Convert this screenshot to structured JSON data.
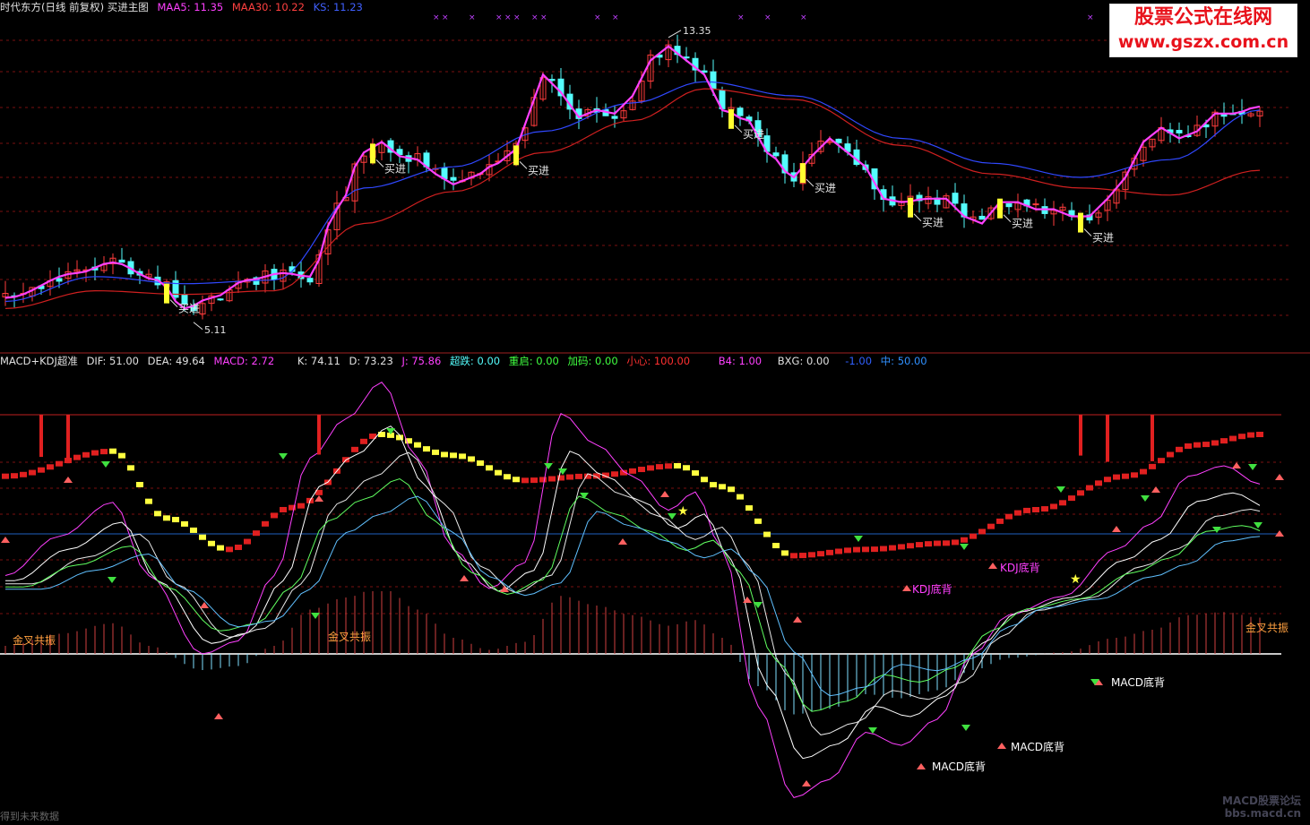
{
  "header_main": {
    "title": "时代东方(日线 前复权) 买进主图",
    "maa5_label": "MAA5: 11.35",
    "maa30_label": "MAA30: 10.22",
    "ks_label": "KS: 11.23"
  },
  "header_indicator": {
    "name": "MACD+KDJ超准",
    "dif": "DIF: 51.00",
    "dea": "DEA: 49.64",
    "macd": "MACD: 2.72",
    "k": "K: 74.11",
    "d": "D: 73.23",
    "j": "J: 75.86",
    "chaodie": "超跌: 0.00",
    "zhongqi": "重启: 0.00",
    "jiama": "加码: 0.00",
    "xiaoxin": "小心: 100.00",
    "b4": "B4: 1.00",
    "bxg": "BXG: 0.00",
    "neg": "-1.00",
    "zhong": "中: 50.00"
  },
  "watermark": {
    "line1": "股票公式在线网",
    "line2": "www.gszx.com.cn",
    "corner1": "MACD股票论坛",
    "corner2": "bbs.macd.cn"
  },
  "footer": "得到未来数据",
  "colors": {
    "up": "#ff3c3c",
    "down": "#54fcfc",
    "maa5": "#ff40ff",
    "maa30": "#d02020",
    "ks": "#3048ff",
    "signal": "#ffff30",
    "grid": "#7a1010"
  },
  "chart_data": [
    {
      "type": "candlestick",
      "title": "时代东方(日线 前复权) 买进主图",
      "series": [
        {
          "name": "MAA5",
          "last": 11.35
        },
        {
          "name": "MAA30",
          "last": 10.22
        },
        {
          "name": "KS",
          "last": 11.23
        }
      ],
      "ylim": [
        4.7,
        13.8
      ],
      "annotations": {
        "high": "13.35",
        "low": "5.11",
        "buy_label": "买进",
        "buy_signals_x": [
          18,
          41,
          57,
          81,
          89,
          101,
          111,
          120
        ]
      },
      "close_path": [
        [
          0,
          5.9
        ],
        [
          8,
          6.6
        ],
        [
          12,
          6.9
        ],
        [
          17,
          6.4
        ],
        [
          20,
          5.6
        ],
        [
          23,
          5.9
        ],
        [
          27,
          6.4
        ],
        [
          31,
          6.6
        ],
        [
          34,
          6.5
        ],
        [
          37,
          8.4
        ],
        [
          40,
          10.0
        ],
        [
          42,
          10.3
        ],
        [
          44,
          9.9
        ],
        [
          46,
          9.8
        ],
        [
          48,
          9.4
        ],
        [
          50,
          9.1
        ],
        [
          52,
          9.3
        ],
        [
          55,
          9.7
        ],
        [
          57,
          10.1
        ],
        [
          59,
          11.5
        ],
        [
          60,
          12.2
        ],
        [
          62,
          11.7
        ],
        [
          64,
          11.0
        ],
        [
          66,
          11.2
        ],
        [
          68,
          11.1
        ],
        [
          70,
          11.6
        ],
        [
          72,
          12.6
        ],
        [
          74,
          13.0
        ],
        [
          76,
          12.6
        ],
        [
          78,
          12.2
        ],
        [
          80,
          11.2
        ],
        [
          83,
          10.9
        ],
        [
          85,
          10.0
        ],
        [
          88,
          9.3
        ],
        [
          90,
          9.9
        ],
        [
          92,
          10.4
        ],
        [
          94,
          10.0
        ],
        [
          96,
          9.6
        ],
        [
          98,
          8.7
        ],
        [
          100,
          8.6
        ],
        [
          103,
          8.7
        ],
        [
          105,
          8.7
        ],
        [
          107,
          8.2
        ],
        [
          109,
          8.0
        ],
        [
          111,
          8.6
        ],
        [
          113,
          8.6
        ],
        [
          115,
          8.4
        ],
        [
          117,
          8.4
        ],
        [
          119,
          8.2
        ],
        [
          121,
          8.2
        ],
        [
          123,
          8.7
        ],
        [
          125,
          9.3
        ],
        [
          127,
          10.3
        ],
        [
          129,
          10.7
        ],
        [
          131,
          10.4
        ],
        [
          133,
          10.6
        ],
        [
          135,
          11.1
        ],
        [
          137,
          11.1
        ],
        [
          140,
          11.3
        ]
      ],
      "maa30_path": [
        [
          0,
          5.6
        ],
        [
          10,
          6.1
        ],
        [
          20,
          6.0
        ],
        [
          30,
          6.1
        ],
        [
          40,
          8.0
        ],
        [
          50,
          8.9
        ],
        [
          60,
          10.0
        ],
        [
          70,
          10.9
        ],
        [
          78,
          11.8
        ],
        [
          88,
          11.5
        ],
        [
          100,
          10.2
        ],
        [
          110,
          9.4
        ],
        [
          120,
          9.0
        ],
        [
          130,
          8.8
        ],
        [
          140,
          9.5
        ]
      ],
      "ks_path": [
        [
          0,
          5.8
        ],
        [
          10,
          6.5
        ],
        [
          20,
          6.3
        ],
        [
          30,
          6.4
        ],
        [
          40,
          9.0
        ],
        [
          50,
          9.6
        ],
        [
          60,
          10.6
        ],
        [
          70,
          11.4
        ],
        [
          78,
          12.0
        ],
        [
          88,
          11.6
        ],
        [
          100,
          10.4
        ],
        [
          110,
          9.7
        ],
        [
          120,
          9.3
        ],
        [
          130,
          9.8
        ],
        [
          140,
          11.2
        ]
      ]
    },
    {
      "type": "line",
      "title": "MACD+KDJ超准",
      "ylim": [
        -100,
        110
      ],
      "series": [
        {
          "name": "DIF",
          "last": 51.0
        },
        {
          "name": "DEA",
          "last": 49.64
        },
        {
          "name": "MACD",
          "last": 2.72
        },
        {
          "name": "K",
          "last": 74.11
        },
        {
          "name": "D",
          "last": 73.23
        },
        {
          "name": "J",
          "last": 75.86
        }
      ],
      "labels": {
        "kdj_bottom": "KDJ底背",
        "macd_bottom": "MACD底背",
        "gold_resonance": "金叉共振"
      },
      "wave_path": [
        [
          0,
          60
        ],
        [
          12,
          72
        ],
        [
          18,
          40
        ],
        [
          25,
          25
        ],
        [
          32,
          45
        ],
        [
          42,
          80
        ],
        [
          50,
          70
        ],
        [
          58,
          58
        ],
        [
          65,
          60
        ],
        [
          75,
          65
        ],
        [
          80,
          55
        ],
        [
          88,
          22
        ],
        [
          96,
          25
        ],
        [
          105,
          28
        ],
        [
          115,
          44
        ],
        [
          125,
          60
        ],
        [
          133,
          75
        ],
        [
          140,
          80
        ]
      ],
      "kd_path": [
        [
          0,
          10
        ],
        [
          6,
          25
        ],
        [
          12,
          38
        ],
        [
          16,
          10
        ],
        [
          22,
          -20
        ],
        [
          26,
          -15
        ],
        [
          30,
          10
        ],
        [
          34,
          55
        ],
        [
          38,
          70
        ],
        [
          42,
          84
        ],
        [
          46,
          55
        ],
        [
          50,
          20
        ],
        [
          54,
          5
        ],
        [
          58,
          15
        ],
        [
          62,
          72
        ],
        [
          66,
          60
        ],
        [
          70,
          48
        ],
        [
          74,
          35
        ],
        [
          77,
          42
        ],
        [
          80,
          20
        ],
        [
          84,
          -40
        ],
        [
          88,
          -75
        ],
        [
          92,
          -68
        ],
        [
          96,
          -50
        ],
        [
          100,
          -55
        ],
        [
          104,
          -45
        ],
        [
          108,
          -20
        ],
        [
          112,
          -5
        ],
        [
          118,
          2
        ],
        [
          124,
          20
        ],
        [
          128,
          30
        ],
        [
          132,
          48
        ],
        [
          136,
          52
        ],
        [
          140,
          45
        ]
      ]
    }
  ]
}
